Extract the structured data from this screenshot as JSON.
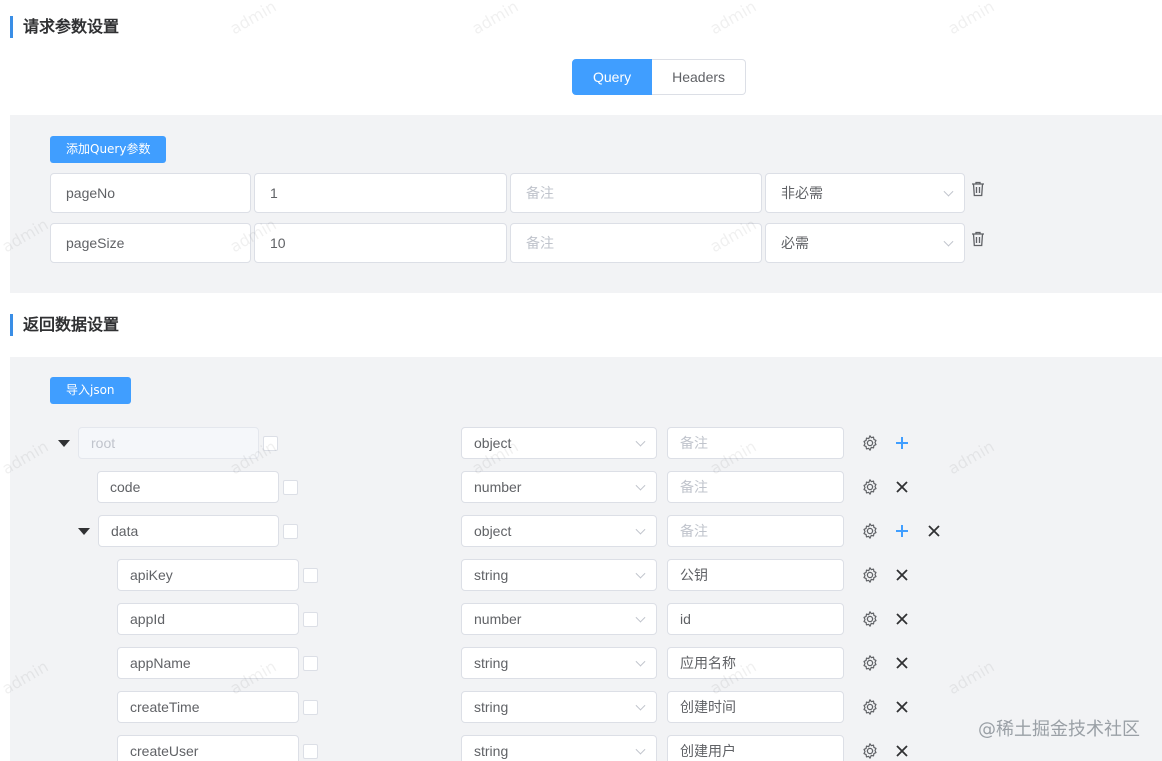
{
  "sections": {
    "request_title": "请求参数设置",
    "response_title": "返回数据设置"
  },
  "tabs": [
    {
      "label": "Query",
      "active": true
    },
    {
      "label": "Headers",
      "active": false
    }
  ],
  "query": {
    "add_button": "添加Query参数",
    "note_placeholder": "备注",
    "rows": [
      {
        "name": "pageNo",
        "value": "1",
        "note": "",
        "required": "非必需"
      },
      {
        "name": "pageSize",
        "value": "10",
        "note": "",
        "required": "必需"
      }
    ]
  },
  "response": {
    "import_button": "导入json",
    "note_placeholder": "备注",
    "tree": [
      {
        "name": "root",
        "type": "object",
        "note": ""
      },
      {
        "name": "code",
        "type": "number",
        "note": ""
      },
      {
        "name": "data",
        "type": "object",
        "note": ""
      },
      {
        "name": "apiKey",
        "type": "string",
        "note": "公钥"
      },
      {
        "name": "appId",
        "type": "number",
        "note": "id"
      },
      {
        "name": "appName",
        "type": "string",
        "note": "应用名称"
      },
      {
        "name": "createTime",
        "type": "string",
        "note": "创建时间"
      },
      {
        "name": "createUser",
        "type": "string",
        "note": "创建用户"
      }
    ]
  },
  "watermark": "admin",
  "brand": "@稀土掘金技术社区",
  "colors": {
    "primary": "#409eff",
    "accent": "#3a8ee6",
    "panel": "#f2f3f5"
  }
}
